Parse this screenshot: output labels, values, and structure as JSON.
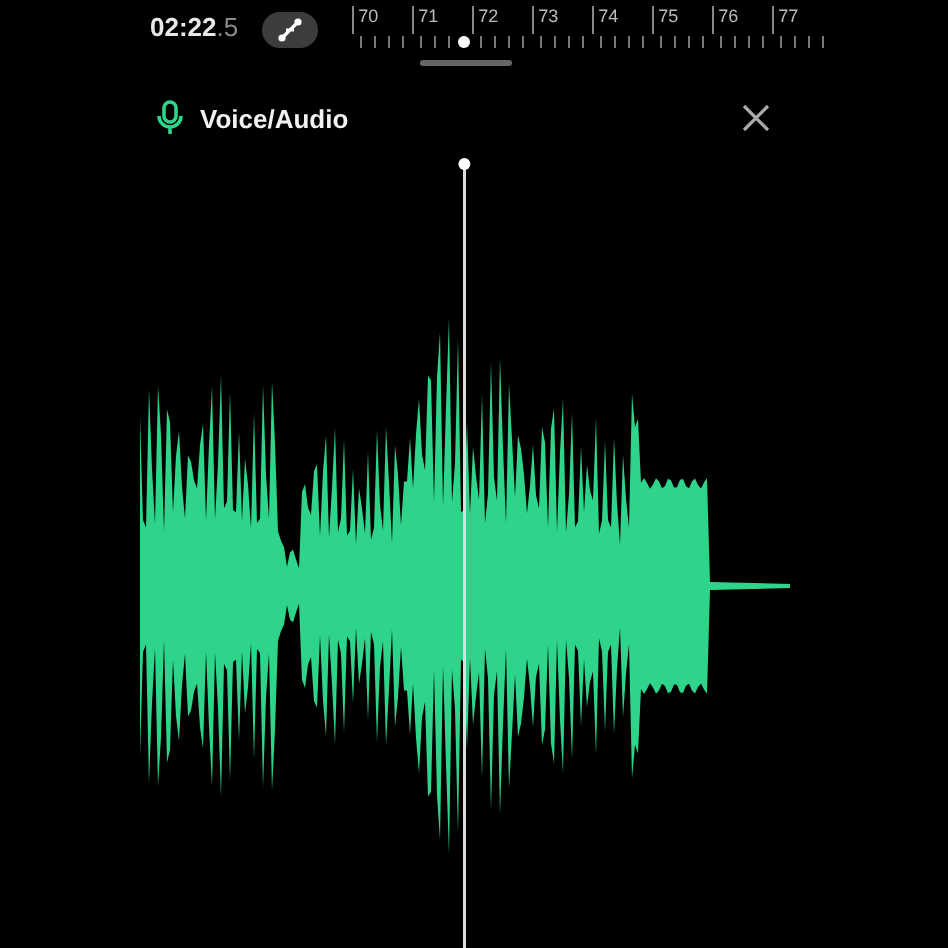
{
  "top_bar": {
    "time": "02:22",
    "time_fraction": ".5",
    "ruler": {
      "labels": [
        "70",
        "71",
        "72",
        "73",
        "74",
        "75",
        "76",
        "77"
      ]
    }
  },
  "track": {
    "title": "Voice/Audio"
  }
}
